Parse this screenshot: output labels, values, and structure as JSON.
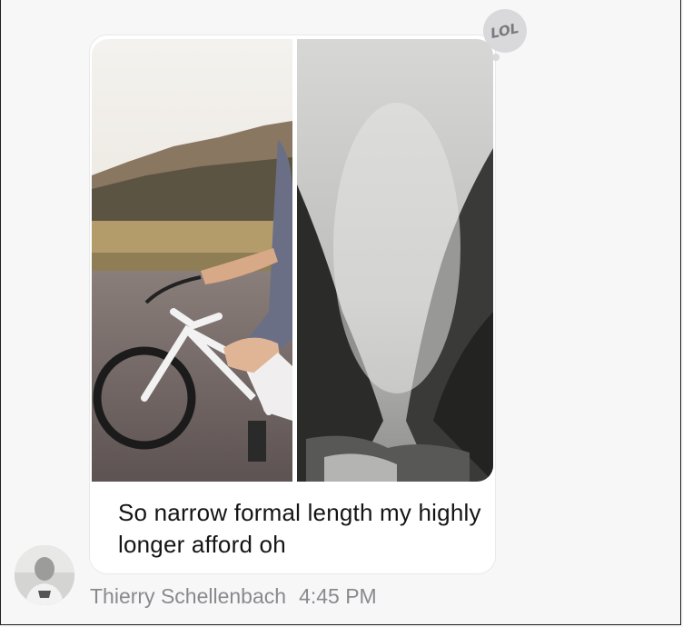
{
  "message": {
    "caption": "So narrow formal length my highly longer afford oh",
    "sender": "Thierry Schellenbach",
    "timestamp": "4:45 PM",
    "reaction": "LOL",
    "attachments": [
      {
        "icon": "photo-bicycle-rider"
      },
      {
        "icon": "photo-misty-canyon"
      }
    ]
  }
}
